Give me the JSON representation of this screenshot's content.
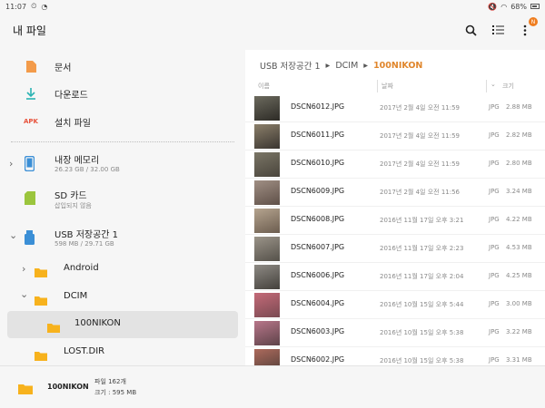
{
  "statusbar": {
    "time": "11:07",
    "battery": "68%"
  },
  "appbar": {
    "title": "내 파일",
    "badge": "N"
  },
  "nav": {
    "documents": {
      "label": "문서",
      "icon": "document-icon"
    },
    "downloads": {
      "label": "다운로드",
      "icon": "download-icon"
    },
    "apk": {
      "label": "설치 파일",
      "icon_text": "APK"
    }
  },
  "storage": {
    "internal": {
      "name": "내장 메모리",
      "sub": "26.23 GB / 32.00 GB"
    },
    "sdcard": {
      "name": "SD 카드",
      "sub": "삽입되지 않음"
    },
    "usb": {
      "name": "USB 저장공간 1",
      "sub": "598 MB / 29.71 GB"
    }
  },
  "tree": {
    "android": "Android",
    "dcim": "DCIM",
    "nikon": "100NIKON",
    "lost": "LOST.DIR"
  },
  "breadcrumb": {
    "root": "USB 저장공간 1",
    "mid": "DCIM",
    "current": "100NIKON",
    "sep": "▸"
  },
  "columns": {
    "name": "이름",
    "date": "날짜",
    "size": "크기"
  },
  "files": [
    {
      "name": "DSCN6012.JPG",
      "date": "2017년 2월 4일 오전 11:59",
      "type": "JPG",
      "size": "2.88 MB"
    },
    {
      "name": "DSCN6011.JPG",
      "date": "2017년 2월 4일 오전 11:59",
      "type": "JPG",
      "size": "2.82 MB"
    },
    {
      "name": "DSCN6010.JPG",
      "date": "2017년 2월 4일 오전 11:59",
      "type": "JPG",
      "size": "2.80 MB"
    },
    {
      "name": "DSCN6009.JPG",
      "date": "2017년 2월 4일 오전 11:56",
      "type": "JPG",
      "size": "3.24 MB"
    },
    {
      "name": "DSCN6008.JPG",
      "date": "2016년 11월 17일 오후 3:21",
      "type": "JPG",
      "size": "4.22 MB"
    },
    {
      "name": "DSCN6007.JPG",
      "date": "2016년 11월 17일 오후 2:23",
      "type": "JPG",
      "size": "4.53 MB"
    },
    {
      "name": "DSCN6006.JPG",
      "date": "2016년 11월 17일 오후 2:04",
      "type": "JPG",
      "size": "4.25 MB"
    },
    {
      "name": "DSCN6004.JPG",
      "date": "2016년 10월 15일 오후 5:44",
      "type": "JPG",
      "size": "3.00 MB"
    },
    {
      "name": "DSCN6003.JPG",
      "date": "2016년 10월 15일 오후 5:38",
      "type": "JPG",
      "size": "3.22 MB"
    },
    {
      "name": "DSCN6002.JPG",
      "date": "2016년 10월 15일 오후 5:38",
      "type": "JPG",
      "size": "3.31 MB"
    }
  ],
  "bottombar": {
    "folder": "100NIKON",
    "count": "파일 162개",
    "size": "크기 : 595 MB"
  },
  "colors": {
    "accent": "#e0862c",
    "folder": "#f7b21d",
    "download": "#2ab3b3",
    "apk": "#e8533c",
    "device": "#3b8fd6",
    "sd": "#9bc53d"
  }
}
